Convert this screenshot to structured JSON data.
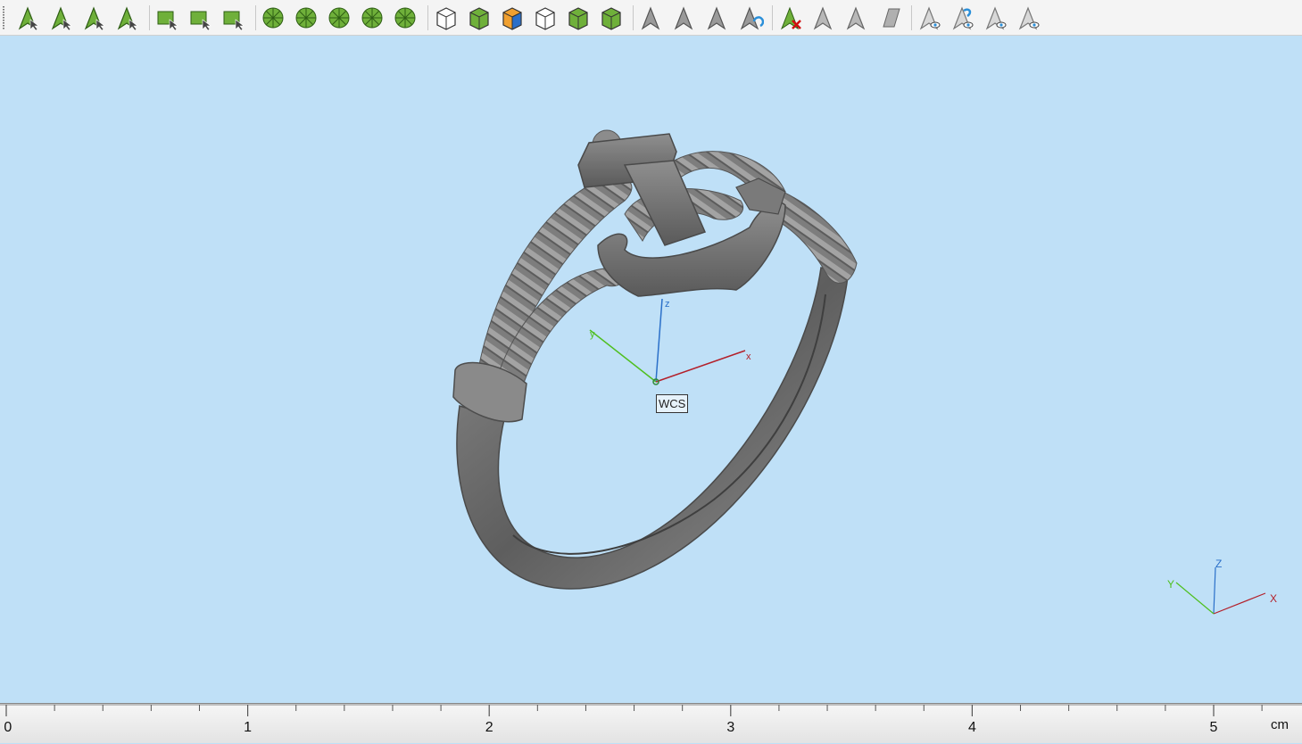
{
  "toolbar": {
    "tools": [
      {
        "name": "select-tool-icon",
        "group": 1
      },
      {
        "name": "select-face-icon",
        "group": 1
      },
      {
        "name": "select-curve-icon",
        "group": 1
      },
      {
        "name": "select-sphere-icon",
        "group": 1
      },
      {
        "name": "select-rectangle-icon",
        "group": 2
      },
      {
        "name": "select-lasso-icon",
        "group": 2
      },
      {
        "name": "select-freehand-icon",
        "group": 2
      },
      {
        "name": "select-mesh-area-icon",
        "group": 3
      },
      {
        "name": "select-brush-icon",
        "group": 3
      },
      {
        "name": "select-star-icon",
        "group": 3
      },
      {
        "name": "select-wheel-icon",
        "group": 3
      },
      {
        "name": "select-wheel-partial-icon",
        "group": 3
      },
      {
        "name": "cube-outline-icon",
        "group": 4
      },
      {
        "name": "cube-green-icon",
        "group": 4
      },
      {
        "name": "cube-orange-face-icon",
        "group": 4
      },
      {
        "name": "cube-wireframe-icon",
        "group": 4
      },
      {
        "name": "cube-red-dot-icon",
        "group": 4
      },
      {
        "name": "cube-highlight-icon",
        "group": 4
      },
      {
        "name": "hide-arrow-icon",
        "group": 5
      },
      {
        "name": "hide-arrow-striped-icon",
        "group": 5
      },
      {
        "name": "hide-arrow-grey-icon",
        "group": 5
      },
      {
        "name": "refresh-arrow-icon",
        "group": 5
      },
      {
        "name": "delete-selection-icon",
        "group": 6
      },
      {
        "name": "dotted-triangle-icon",
        "group": 6
      },
      {
        "name": "copy-triangle-icon",
        "group": 6
      },
      {
        "name": "parallelogram-icon",
        "group": 6
      },
      {
        "name": "show-hidden-icon",
        "group": 7
      },
      {
        "name": "swap-visibility-icon",
        "group": 7
      },
      {
        "name": "show-all-icon",
        "group": 7
      },
      {
        "name": "show-plane-icon",
        "group": 7
      }
    ]
  },
  "viewport": {
    "background": "#bfe0f7",
    "wcs_label": "WCS",
    "main_axes": {
      "x": "x",
      "y": "y",
      "z": "z"
    },
    "corner_axes": {
      "x": "X",
      "y": "Y",
      "z": "Z"
    },
    "colors": {
      "x_axis": "#b3202a",
      "y_axis": "#4fbf1f",
      "z_axis": "#2a6fc9",
      "model": "#7a7a7a"
    }
  },
  "ruler": {
    "labels": [
      "0",
      "1",
      "2",
      "3",
      "4",
      "5"
    ],
    "unit": "cm"
  }
}
